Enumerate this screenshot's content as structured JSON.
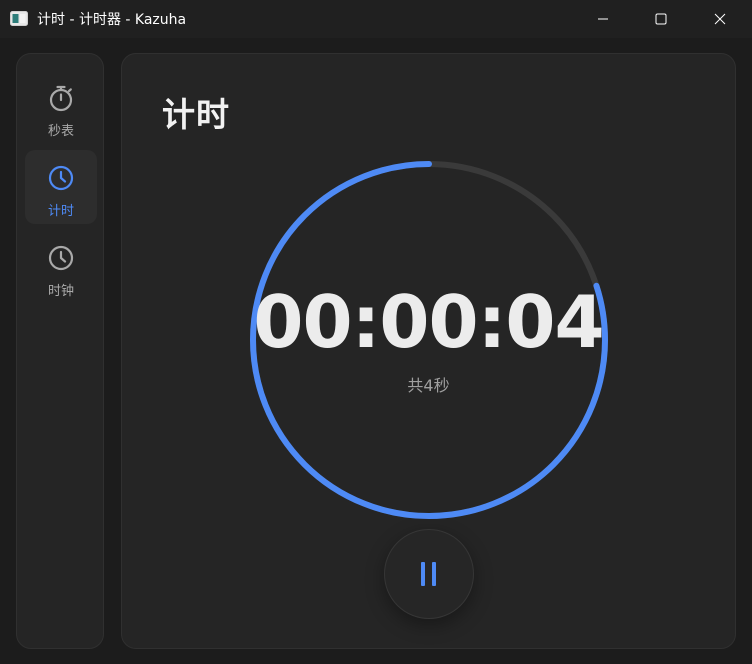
{
  "window": {
    "title": "计时 - 计时器 - Kazuha"
  },
  "titlebar_buttons": {
    "minimize_icon": "minimize-icon",
    "maximize_icon": "maximize-icon",
    "close_icon": "close-icon"
  },
  "sidebar": {
    "items": [
      {
        "label": "秒表",
        "icon": "stopwatch-icon",
        "active": false
      },
      {
        "label": "计时",
        "icon": "clock-icon",
        "active": true
      },
      {
        "label": "时钟",
        "icon": "clock-icon",
        "active": false
      }
    ]
  },
  "main": {
    "title": "计时",
    "time": "00:00:04",
    "total": "共4秒",
    "progress": 0.8,
    "pause_icon": "pause-icon"
  },
  "colors": {
    "accent": "#4e8af5",
    "track": "#3a3a3a",
    "background": "#1c1c1c",
    "card": "#252525"
  }
}
